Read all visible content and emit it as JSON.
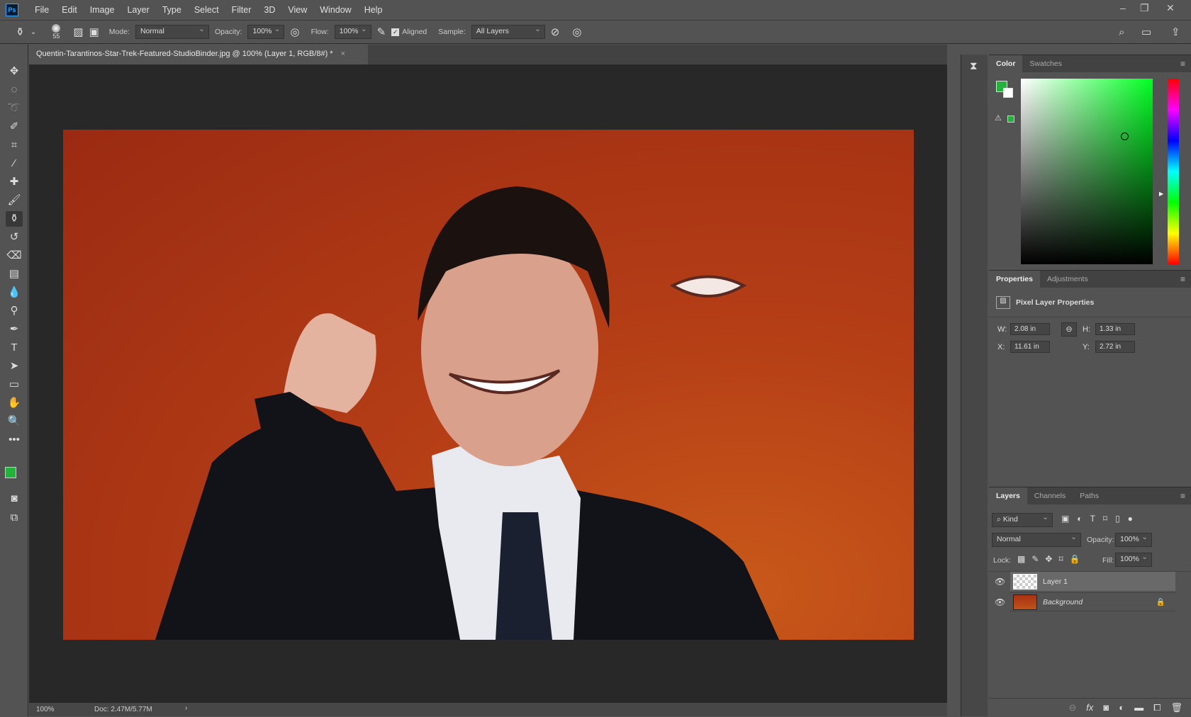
{
  "app": {
    "logo": "Ps",
    "menu": [
      "File",
      "Edit",
      "Image",
      "Layer",
      "Type",
      "Select",
      "Filter",
      "3D",
      "View",
      "Window",
      "Help"
    ]
  },
  "options": {
    "brush_size": "55",
    "mode_label": "Mode:",
    "mode": "Normal",
    "opacity_label": "Opacity:",
    "opacity": "100%",
    "flow_label": "Flow:",
    "flow": "100%",
    "aligned_label": "Aligned",
    "aligned": true,
    "sample_label": "Sample:",
    "sample": "All Layers"
  },
  "document": {
    "tab_title": "Quentin-Tarantinos-Star-Trek-Featured-StudioBinder.jpg @ 100% (Layer 1, RGB/8#) *",
    "close": "×"
  },
  "status": {
    "zoom": "100%",
    "doc": "Doc: 2.47M/5.77M",
    "arrow": "›"
  },
  "colors": {
    "foreground": "#22b33a",
    "background": "#ffffff"
  },
  "color_panel": {
    "tabs": [
      "Color",
      "Swatches"
    ]
  },
  "properties": {
    "tabs": [
      "Properties",
      "Adjustments"
    ],
    "title": "Pixel Layer Properties",
    "w_label": "W:",
    "w": "2.08 in",
    "h_label": "H:",
    "h": "1.33 in",
    "x_label": "X:",
    "x": "11.61 in",
    "y_label": "Y:",
    "y": "2.72 in"
  },
  "layers": {
    "tabs": [
      "Layers",
      "Channels",
      "Paths"
    ],
    "filter": "Kind",
    "blend": "Normal",
    "opacity_label": "Opacity:",
    "opacity": "100%",
    "lock_label": "Lock:",
    "fill_label": "Fill:",
    "fill": "100%",
    "items": [
      {
        "name": "Layer 1",
        "selected": true
      },
      {
        "name": "Background",
        "locked": true
      }
    ]
  }
}
